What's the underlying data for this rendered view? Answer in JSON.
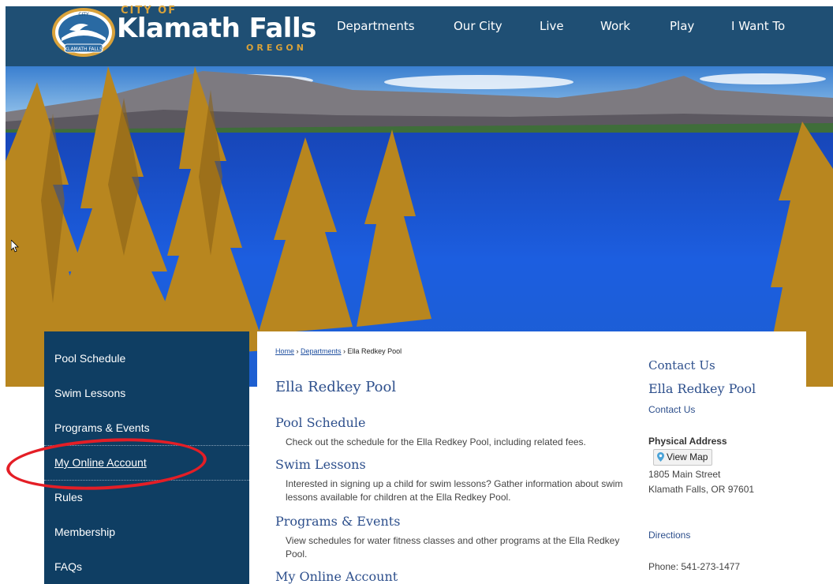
{
  "header": {
    "logo": {
      "city_of": "CITY OF",
      "name": "Klamath Falls",
      "state": "OREGON",
      "seal_top": "CITY",
      "seal_bottom": "KLAMATH FALLS"
    },
    "nav": [
      {
        "label": "Departments"
      },
      {
        "label": "Our City"
      },
      {
        "label": "Live"
      },
      {
        "label": "Work"
      },
      {
        "label": "Play"
      },
      {
        "label": "I Want To"
      }
    ]
  },
  "sidebar": {
    "items": [
      {
        "label": "Pool Schedule"
      },
      {
        "label": "Swim Lessons"
      },
      {
        "label": "Programs & Events"
      },
      {
        "label": "My Online Account"
      },
      {
        "label": "Rules"
      },
      {
        "label": "Membership"
      },
      {
        "label": "FAQs"
      }
    ]
  },
  "breadcrumb": {
    "home": "Home",
    "sep1": " › ",
    "departments": "Departments",
    "sep2": " › ",
    "current": "Ella Redkey Pool"
  },
  "main": {
    "title": "Ella Redkey Pool",
    "sections": [
      {
        "title": "Pool Schedule",
        "desc": "Check out the schedule for the Ella Redkey Pool, including related fees."
      },
      {
        "title": "Swim Lessons",
        "desc": "Interested in signing up a child for swim lessons? Gather information about swim lessons available for children at the Ella Redkey Pool."
      },
      {
        "title": "Programs & Events",
        "desc": "View schedules for water fitness classes and other programs at the Ella Redkey Pool."
      },
      {
        "title": "My Online Account",
        "desc": ""
      }
    ]
  },
  "contact": {
    "heading": "Contact Us",
    "name": "Ella Redkey Pool",
    "contact_link": "Contact Us",
    "address_label": "Physical Address",
    "map_button": "View Map",
    "address_line1": "1805 Main Street",
    "address_line2": "Klamath Falls, OR 97601",
    "directions": "Directions",
    "phone": "Phone: 541-273-1477"
  },
  "colors": {
    "header_bg": "#1f4f74",
    "sidebar_bg": "#0f3e63",
    "accent_gold": "#d9a23a",
    "heading_blue": "#2d4f8c",
    "annotation_red": "#e41e26"
  }
}
